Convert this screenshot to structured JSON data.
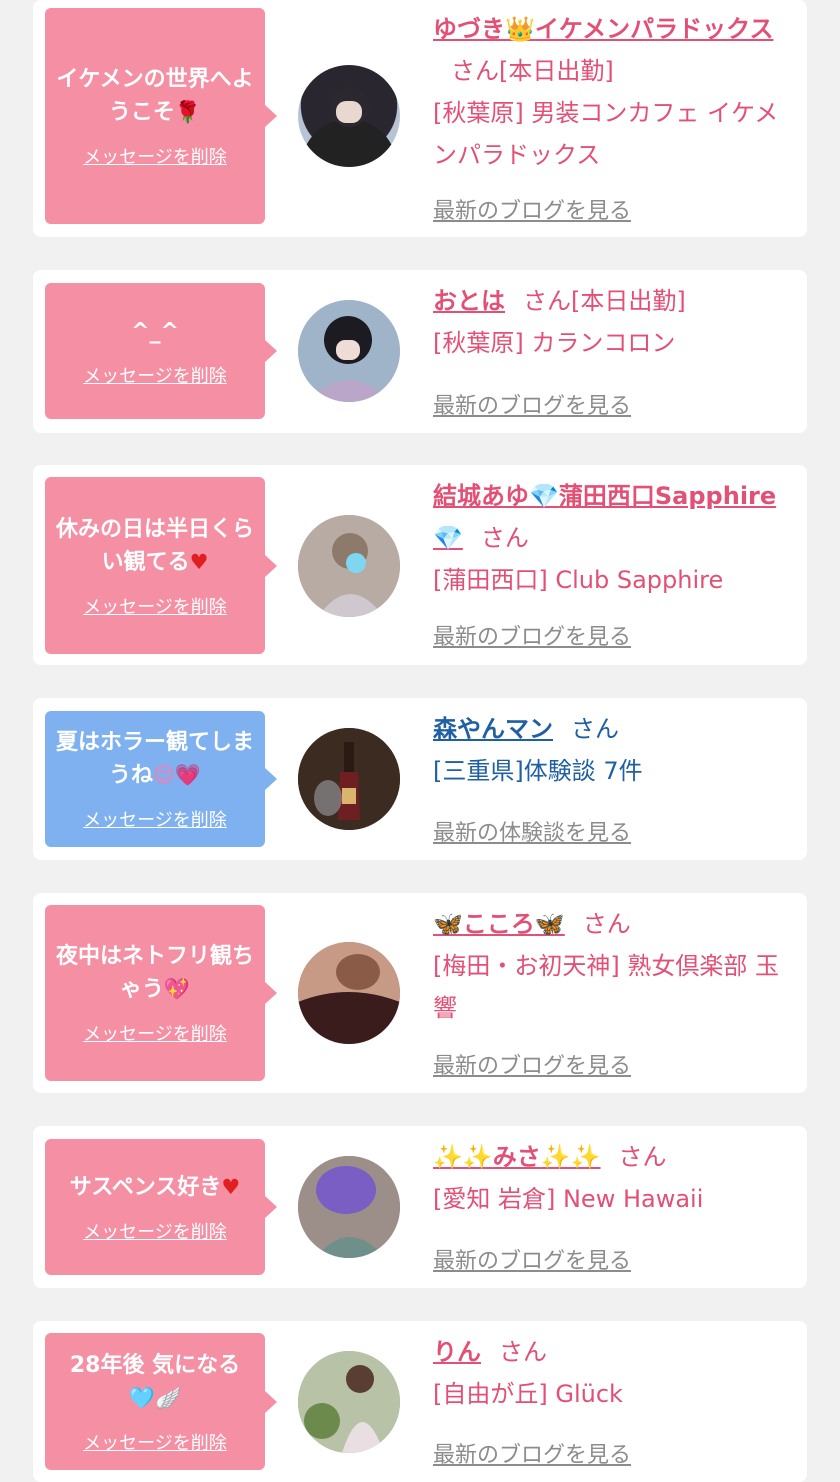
{
  "delete_label": "メッセージを削除",
  "honorific": "さん",
  "cards": [
    {
      "message": "イケメンの世界へようこそ",
      "message_emoji": "🌹",
      "name_prefix": "",
      "name_main": "ゆづき",
      "name_icon": "👑",
      "name_tail": "イケメンパラドックス",
      "status": "[本日出勤]",
      "shop": "[秋葉原] 男装コンカフェ イケメンパラドックス",
      "link": "最新のブログを見る"
    },
    {
      "message": "^_^",
      "name_main": "おとは",
      "status": "[本日出勤]",
      "shop": "[秋葉原] カランコロン",
      "link": "最新のブログを見る"
    },
    {
      "message": "休みの日は半日くらい観てる",
      "message_emoji": "♥",
      "name_main": "結城あゆ",
      "name_icon": "💎",
      "name_tail": "蒲田西口Sapphire",
      "name_icon2": "💎",
      "shop": "[蒲田西口] Club Sapphire",
      "link": "最新のブログを見る"
    },
    {
      "message": "夏はホラー観てしまうね",
      "message_emoji": "😌💗",
      "name_main": "森やんマン",
      "shop": "[三重県]体験談 7件",
      "link": "最新の体験談を見る"
    },
    {
      "message": "夜中はネトフリ観ちゃう",
      "message_emoji": "💖",
      "name_icon": "🦋",
      "name_main": "こころ",
      "name_icon2": "🦋",
      "shop": "[梅田・お初天神] 熟女倶楽部 玉響",
      "link": "最新のブログを見る"
    },
    {
      "message": "サスペンス好き",
      "message_emoji": "♥",
      "name_icon": "✨✨",
      "name_main": "みさ",
      "name_icon2": "✨✨",
      "shop": "[愛知 岩倉] New Hawaii",
      "link": "最新のブログを見る"
    },
    {
      "message": "28年後 気になる",
      "message_emoji": "🩵🪽",
      "name_main": "りん",
      "shop": "[自由が丘] Glück",
      "link": "最新のブログを見る"
    }
  ],
  "colors": {
    "background": "#f1f1f1",
    "card": "#ffffff",
    "bubble_pink": "#f58fa3",
    "bubble_blue": "#7fb0ef",
    "name_pink": "#e35075",
    "name_blue": "#1f5fa3",
    "link_gray": "#8c8c8c"
  }
}
